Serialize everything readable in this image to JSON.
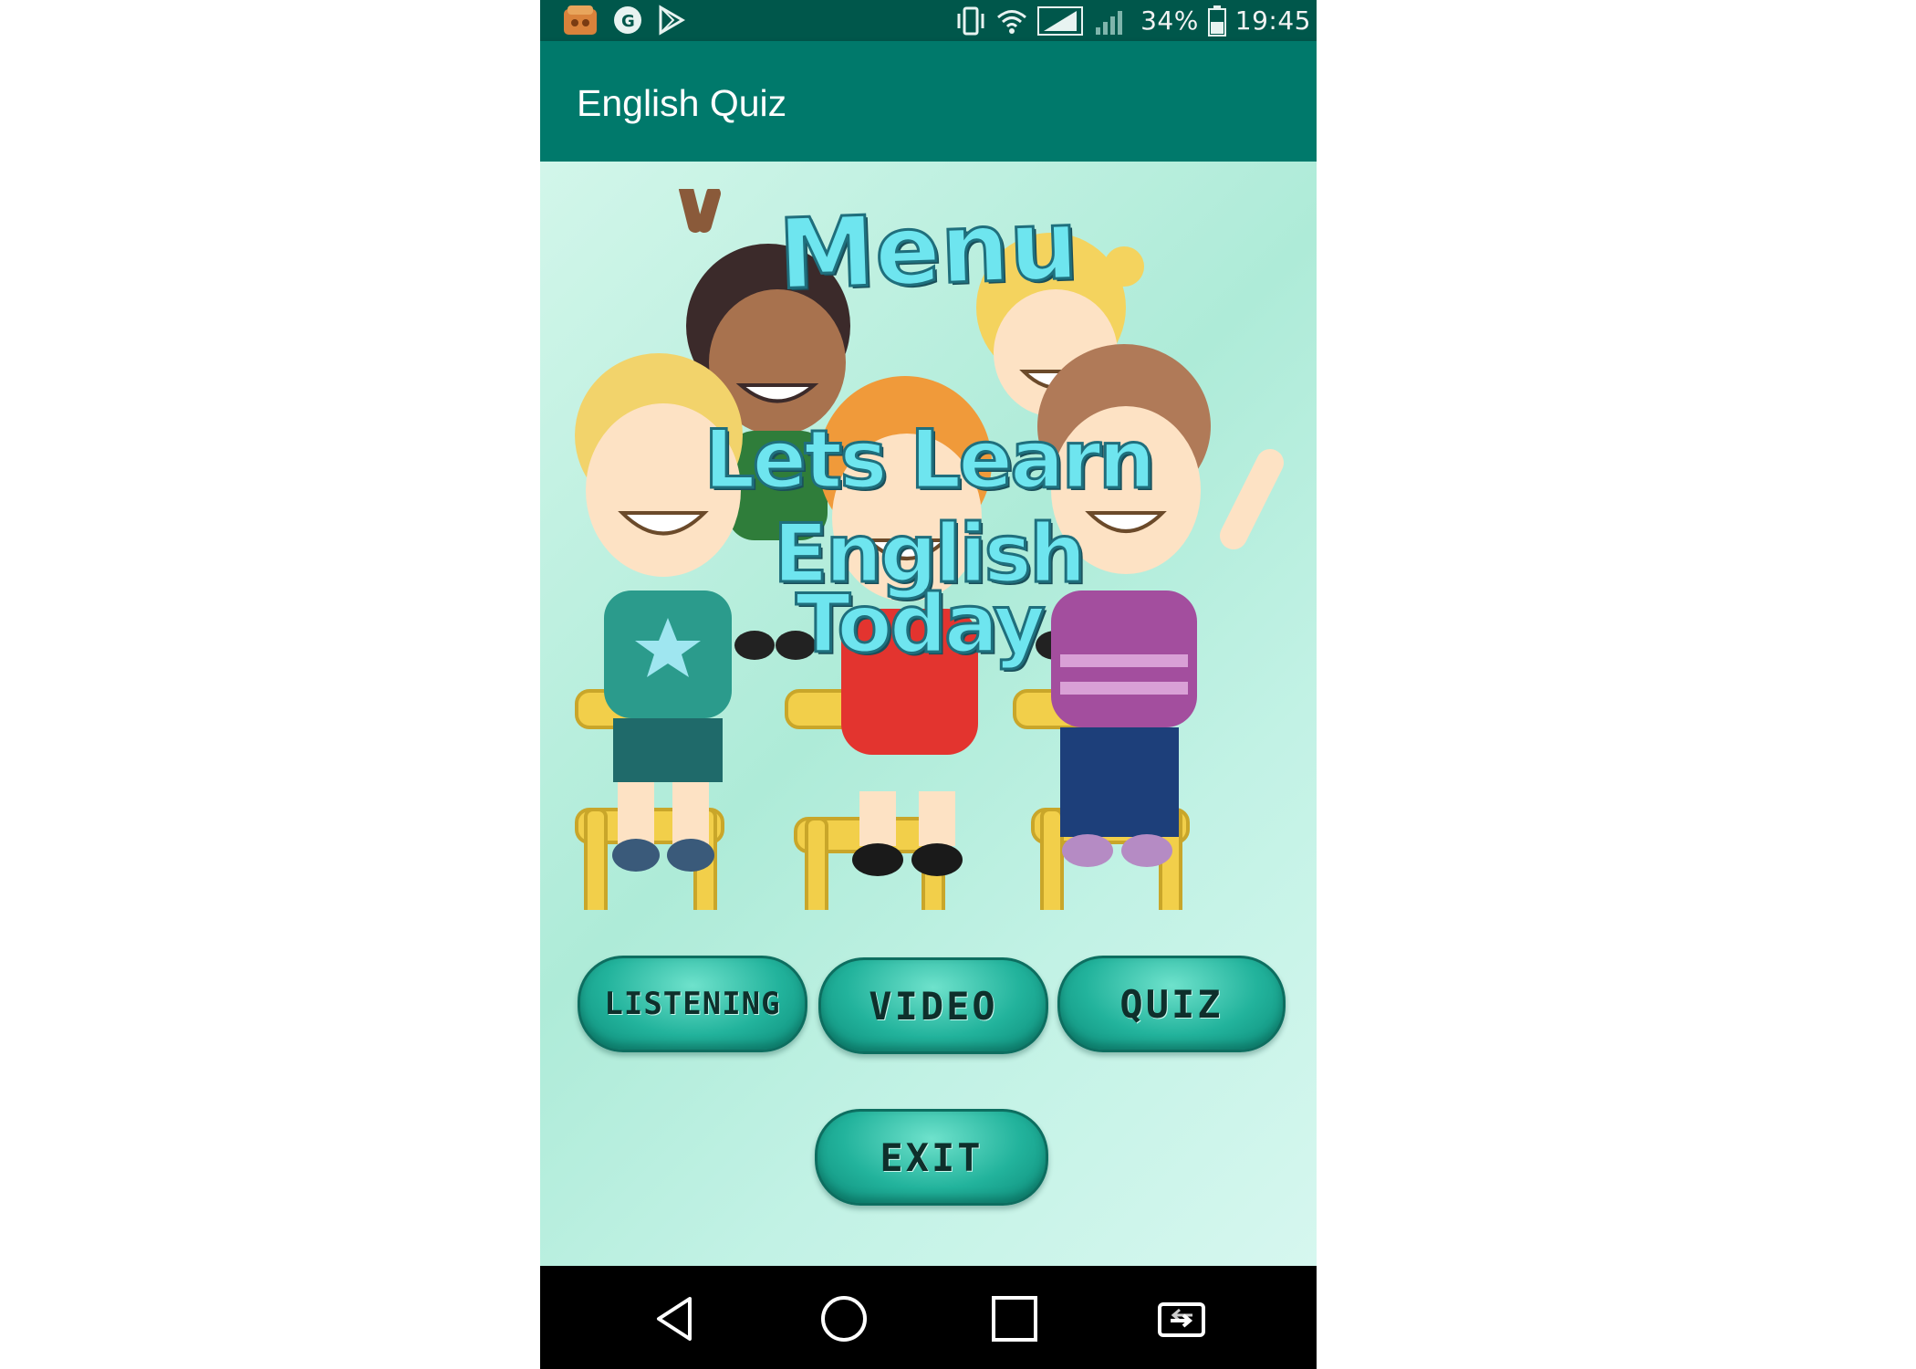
{
  "status_bar": {
    "battery_percent": "34%",
    "time": "19:45",
    "left_icons": [
      "app-notification-icon",
      "shop-notification-icon",
      "play-store-icon"
    ],
    "right_icons": [
      "vibrate-icon",
      "wifi-icon",
      "signal-icon",
      "signal-secondary-icon",
      "battery-icon"
    ]
  },
  "toolbar": {
    "title": "English Quiz"
  },
  "hero": {
    "title": "Menu",
    "subtitle_line1": "Lets Learn English",
    "subtitle_line2": "Today"
  },
  "menu_buttons": {
    "listening": "LISTENING",
    "video": "VIDEO",
    "quiz": "QUIZ",
    "exit": "EXIT"
  },
  "nav_bar": {
    "icons": [
      "back-icon",
      "home-icon",
      "recents-icon",
      "screen-switch-icon"
    ]
  },
  "colors": {
    "status_bar": "#00574b",
    "toolbar": "#00796b",
    "button_fill": "#22b39c",
    "hero_text": "#6ee5ef"
  }
}
